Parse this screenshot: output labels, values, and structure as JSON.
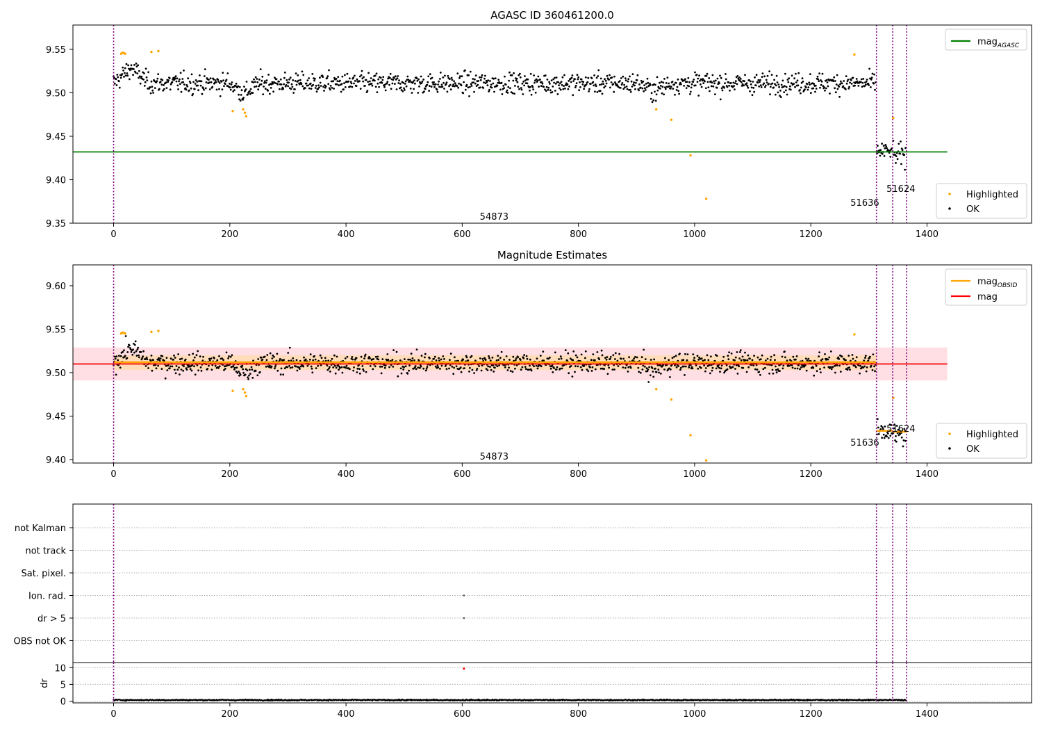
{
  "chart_data": [
    {
      "type": "scatter",
      "title": "AGASC ID 360461200.0",
      "xlim": [
        -70,
        1580
      ],
      "ylim": [
        9.35,
        9.578
      ],
      "xticks": [
        0,
        200,
        400,
        600,
        800,
        1000,
        1200,
        1400
      ],
      "yticks": [
        9.35,
        9.4,
        9.45,
        9.5,
        9.55
      ],
      "ytick_labels": [
        "9.35",
        "9.40",
        "9.45",
        "9.50",
        "9.55"
      ],
      "obs_boundaries": [
        0,
        1313,
        1341,
        1365
      ],
      "obs_labels": [
        {
          "text": "54873",
          "x": 655,
          "y": 9.358
        },
        {
          "text": "51636",
          "x": 1293,
          "y": 9.374
        },
        {
          "text": "51624",
          "x": 1355,
          "y": 9.39
        }
      ],
      "lines": [
        {
          "name": "mag_AGASC",
          "label": "mag",
          "sub": "AGASC",
          "y": 9.432,
          "x": [
            -70,
            1435
          ],
          "color": "#008000"
        }
      ],
      "bands": [],
      "segments": [],
      "legend_upper": [
        {
          "label": "mag",
          "sub": "AGASC",
          "color": "#008000"
        }
      ],
      "legend_lower": [
        {
          "label": "Highlighted",
          "color": "#ffa500"
        },
        {
          "label": "OK",
          "color": "#000000"
        }
      ],
      "series": [
        {
          "name": "OK",
          "color": "#000000",
          "segments": [
            {
              "x0": 0,
              "x1": 1312,
              "base": 9.511,
              "noise": 0.011,
              "features": [
                {
                  "x0": 0,
                  "x1": 60,
                  "shift": 0.018
                },
                {
                  "x0": 200,
                  "x1": 250,
                  "shift": -0.012
                },
                {
                  "x0": 900,
                  "x1": 960,
                  "shift": -0.008
                }
              ]
            },
            {
              "x0": 1314,
              "x1": 1340,
              "base": 9.433,
              "noise": 0.009,
              "features": []
            },
            {
              "x0": 1342,
              "x1": 1364,
              "base": 9.428,
              "noise": 0.012,
              "features": []
            }
          ]
        },
        {
          "name": "Highlighted",
          "color": "#ffa500",
          "points": [
            [
              13,
              9.545
            ],
            [
              15,
              9.546
            ],
            [
              17,
              9.546
            ],
            [
              20,
              9.545
            ],
            [
              65,
              9.547
            ],
            [
              77,
              9.548
            ],
            [
              205,
              9.479
            ],
            [
              223,
              9.481
            ],
            [
              226,
              9.477
            ],
            [
              228,
              9.473
            ],
            [
              934,
              9.481
            ],
            [
              960,
              9.469
            ],
            [
              993,
              9.428
            ],
            [
              1020,
              9.378
            ],
            [
              1275,
              9.544
            ],
            [
              1342,
              9.471
            ]
          ]
        }
      ]
    },
    {
      "type": "scatter",
      "title": "Magnitude Estimates",
      "xlim": [
        -70,
        1580
      ],
      "ylim": [
        9.396,
        9.624
      ],
      "xticks": [
        0,
        200,
        400,
        600,
        800,
        1000,
        1200,
        1400
      ],
      "yticks": [
        9.4,
        9.45,
        9.5,
        9.55,
        9.6
      ],
      "ytick_labels": [
        "9.40",
        "9.45",
        "9.50",
        "9.55",
        "9.60"
      ],
      "obs_boundaries": [
        0,
        1313,
        1341,
        1365
      ],
      "obs_labels": [
        {
          "text": "54873",
          "x": 655,
          "y": 9.404
        },
        {
          "text": "51636",
          "x": 1293,
          "y": 9.42
        },
        {
          "text": "51624",
          "x": 1355,
          "y": 9.436
        }
      ],
      "lines": [
        {
          "name": "mag",
          "y": 9.51,
          "x": [
            -70,
            1435
          ],
          "color": "#ff0000"
        }
      ],
      "bands": [
        {
          "y0": 9.491,
          "y1": 9.529,
          "x": [
            -70,
            1435
          ],
          "color": "#ffc0c8",
          "opacity": 0.5
        },
        {
          "y0": 9.503,
          "y1": 9.52,
          "x": [
            0,
            1313
          ],
          "color": "#ffdca0",
          "opacity": 0.6
        }
      ],
      "segments": [
        {
          "x0": 0,
          "x1": 1313,
          "y": 9.512,
          "color": "#ffa500"
        },
        {
          "x0": 1313,
          "x1": 1341,
          "y": 9.433,
          "color": "#ffa500"
        },
        {
          "x0": 1341,
          "x1": 1365,
          "y": 9.432,
          "color": "#ffa500"
        }
      ],
      "legend_upper": [
        {
          "label": "mag",
          "sub": "OBSID",
          "color": "#ffa500"
        },
        {
          "label": "mag",
          "color": "#ff0000"
        }
      ],
      "legend_lower": [
        {
          "label": "Highlighted",
          "color": "#ffa500"
        },
        {
          "label": "OK",
          "color": "#000000"
        }
      ],
      "series": [
        {
          "name": "OK",
          "color": "#000000",
          "segments": [
            {
              "x0": 0,
              "x1": 1312,
              "base": 9.511,
              "noise": 0.011,
              "features": [
                {
                  "x0": 0,
                  "x1": 60,
                  "shift": 0.018
                },
                {
                  "x0": 200,
                  "x1": 250,
                  "shift": -0.012
                },
                {
                  "x0": 900,
                  "x1": 960,
                  "shift": -0.008
                }
              ]
            },
            {
              "x0": 1314,
              "x1": 1340,
              "base": 9.433,
              "noise": 0.009,
              "features": []
            },
            {
              "x0": 1342,
              "x1": 1364,
              "base": 9.428,
              "noise": 0.012,
              "features": []
            }
          ]
        },
        {
          "name": "Highlighted",
          "color": "#ffa500",
          "points": [
            [
              13,
              9.545
            ],
            [
              15,
              9.546
            ],
            [
              17,
              9.546
            ],
            [
              20,
              9.545
            ],
            [
              65,
              9.547
            ],
            [
              77,
              9.548
            ],
            [
              205,
              9.479
            ],
            [
              223,
              9.481
            ],
            [
              226,
              9.477
            ],
            [
              228,
              9.473
            ],
            [
              934,
              9.481
            ],
            [
              960,
              9.469
            ],
            [
              993,
              9.428
            ],
            [
              1020,
              9.399
            ],
            [
              1275,
              9.544
            ],
            [
              1342,
              9.471
            ]
          ]
        }
      ]
    },
    {
      "type": "scatter",
      "title": "",
      "xlim": [
        -70,
        1580
      ],
      "categories": [
        "not Kalman",
        "not track",
        "Sat. pixel.",
        "Ion. rad.",
        "dr > 5",
        "OBS not OK"
      ],
      "obs_boundaries": [
        0,
        1313,
        1341,
        1365
      ],
      "flag_points": [
        {
          "category": "Ion. rad.",
          "x": 603
        },
        {
          "category": "dr > 5",
          "x": 603
        }
      ],
      "legend_upper": [],
      "legend_lower": []
    },
    {
      "type": "scatter",
      "title": "",
      "ylabel": "dr",
      "xlim": [
        -70,
        1580
      ],
      "ylim": [
        -0.5,
        11.5
      ],
      "xticks": [
        0,
        200,
        400,
        600,
        800,
        1000,
        1200,
        1400
      ],
      "yticks": [
        0,
        5,
        10
      ],
      "ytick_labels": [
        "0",
        "5",
        "10"
      ],
      "obs_boundaries": [
        0,
        1313,
        1341,
        1365
      ],
      "dr_base": 0.35,
      "dr_noise": 0.2,
      "outliers": [
        {
          "x": 603,
          "y": 9.7,
          "color": "#ff0000"
        }
      ]
    }
  ]
}
